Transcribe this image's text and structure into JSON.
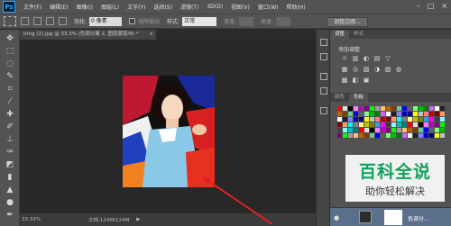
{
  "app": {
    "logo": "Ps"
  },
  "menu": [
    "文件(F)",
    "编辑(E)",
    "图像(I)",
    "图层(L)",
    "文字(Y)",
    "选择(S)",
    "滤镜(T)",
    "3D(D)",
    "视图(V)",
    "窗口(W)",
    "帮助(H)"
  ],
  "window_controls": [
    "–",
    "□",
    "×"
  ],
  "options": {
    "feather_label": "羽化:",
    "feather_value": "0 像素",
    "antialias_label": "消除锯齿",
    "style_label": "样式:",
    "style_value": "正常",
    "width_label": "宽度:",
    "height_label": "高度:",
    "refine_button": "调整边缘..."
  },
  "document": {
    "tab_title": "timg (2).jpg @ 33.3% (色调分离 2, 图层蒙版/8) *",
    "close": "×"
  },
  "status": {
    "zoom": "33.33%",
    "doc_info": "文档:124M/124M",
    "arrow": "▶"
  },
  "panels": {
    "top_tabs": [
      "调整",
      "样式"
    ],
    "adjustments_title": "添加调整",
    "swatch_tabs": [
      "颜色",
      "色板"
    ],
    "adjustment_icons": [
      "☼",
      "▥",
      "◐",
      "▤",
      "▽",
      "▦",
      "◎",
      "▧",
      "◑",
      "▨",
      "◍",
      "▩",
      "◧",
      "▣"
    ]
  },
  "swatch_colors": [
    "#ff0000",
    "#ffff00",
    "#00ff00",
    "#00ffff",
    "#0000ff",
    "#ff00ff",
    "#ffffff",
    "#e0e0e0",
    "#c0c0c0",
    "#a0a0a0",
    "#808080",
    "#606060",
    "#404040",
    "#202020",
    "#000000",
    "#ff7f7f",
    "#ffbf7f",
    "#ffff7f",
    "#7fff7f",
    "#7fffff",
    "#7f7fff",
    "#ff7fff",
    "#c00000",
    "#c06000",
    "#c0c000",
    "#00c000",
    "#00c0c0",
    "#0000c0",
    "#c000c0",
    "#800000",
    "#804000",
    "#808000",
    "#008000",
    "#008080",
    "#000080",
    "#800080",
    "#ff9966",
    "#66cc99",
    "#3399ff",
    "#cc66ff"
  ],
  "watermark": {
    "title": "百科全说",
    "subtitle": "助你轻松解决"
  },
  "layers": {
    "eye": "●",
    "name": "色调分..."
  }
}
